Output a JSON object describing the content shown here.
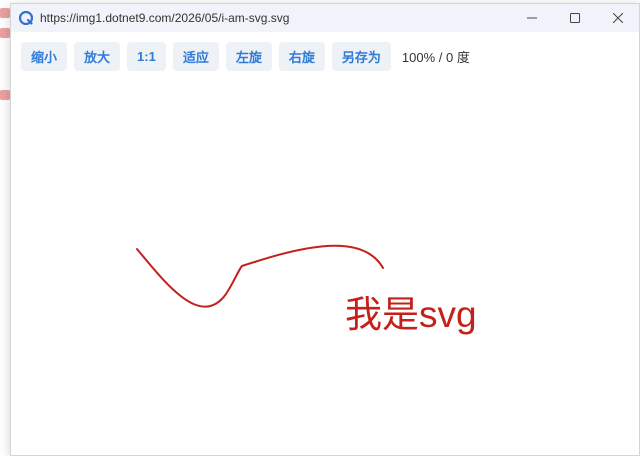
{
  "window": {
    "url": "https://img1.dotnet9.com/2026/05/i-am-svg.svg"
  },
  "toolbar": {
    "buttons": [
      "缩小",
      "放大",
      "1:1",
      "适应",
      "左旋",
      "右旋",
      "另存为"
    ],
    "zoom_percent": "100%",
    "rotation_degrees": "0 度",
    "status": "100% / 0 度"
  },
  "image": {
    "caption": "我是svg",
    "stroke_color": "#c4201c"
  },
  "colors": {
    "button_text": "#2f7bd8",
    "button_bg": "#eef1f6",
    "titlebar_bg": "#f0f3f9"
  }
}
